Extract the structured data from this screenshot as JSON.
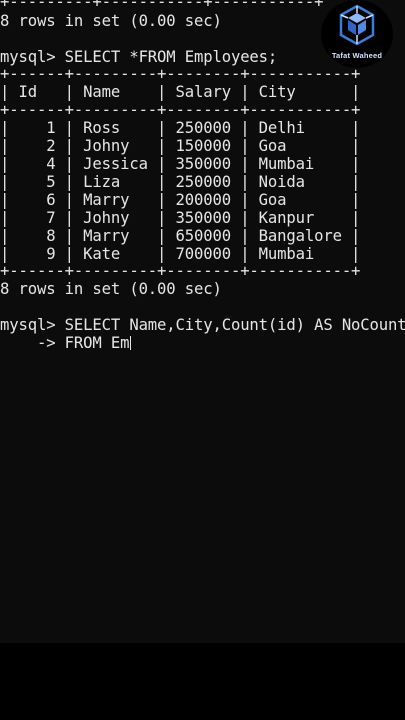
{
  "terminal": {
    "prev_result": "8 rows in set (0.00 sec)",
    "query1_prompt": "mysql> SELECT *FROM Employees;",
    "table": {
      "border": "+------+---------+--------+-----------+",
      "header": "| Id   | Name    | Salary | City      |",
      "rows": [
        "|    1 | Ross    | 250000 | Delhi     |",
        "|    2 | Johny   | 150000 | Goa       |",
        "|    4 | Jessica | 350000 | Mumbai    |",
        "|    5 | Liza    | 250000 | Noida     |",
        "|    6 | Marry   | 200000 | Goa       |",
        "|    7 | Johny   | 350000 | Kanpur    |",
        "|    8 | Marry   | 650000 | Bangalore |",
        "|    9 | Kate    | 700000 | Mumbai    |"
      ]
    },
    "result_summary": "8 rows in set (0.00 sec)",
    "query2_line1": "mysql> SELECT Name,City,Count(id) AS NoCount",
    "query2_line2": "    -> FROM Em"
  },
  "watermark": {
    "text": "Tafat Waheed",
    "color": "#3d7bd9"
  },
  "colors": {
    "terminal_bg": "#0c0c0c",
    "text": "#e6e6e6"
  }
}
